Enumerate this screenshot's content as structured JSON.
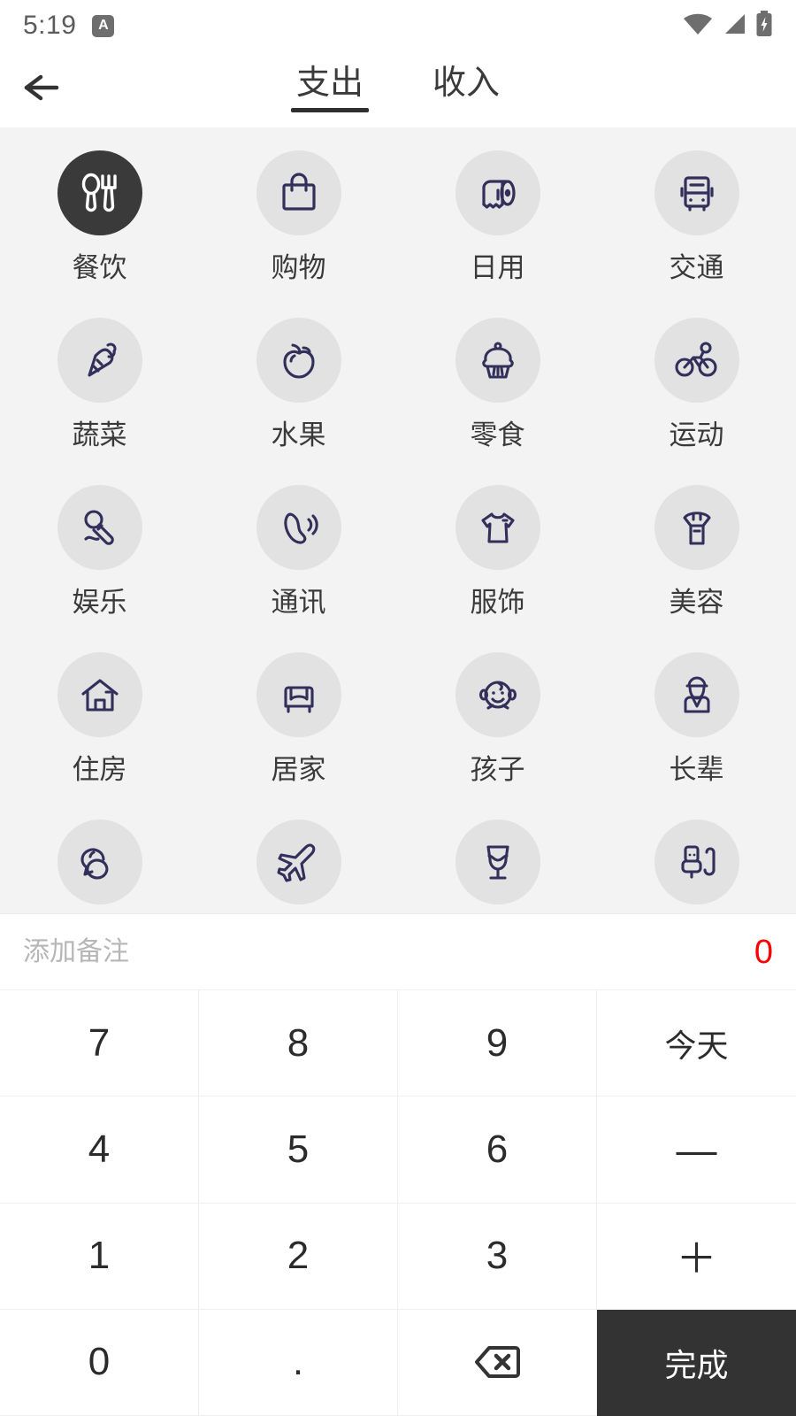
{
  "statusbar": {
    "time": "5:19",
    "badge_letter": "A",
    "icons": [
      "wifi-icon",
      "cellular-signal-icon",
      "battery-charging-icon"
    ]
  },
  "header": {
    "back_icon": "back-arrow-icon",
    "tabs": [
      {
        "label": "支出",
        "active": true
      },
      {
        "label": "收入",
        "active": false
      }
    ]
  },
  "categories": [
    {
      "label": "餐饮",
      "icon": "spoon-fork-icon",
      "selected": true
    },
    {
      "label": "购物",
      "icon": "shopping-bag-icon",
      "selected": false
    },
    {
      "label": "日用",
      "icon": "toilet-paper-icon",
      "selected": false
    },
    {
      "label": "交通",
      "icon": "bus-icon",
      "selected": false
    },
    {
      "label": "蔬菜",
      "icon": "carrot-icon",
      "selected": false
    },
    {
      "label": "水果",
      "icon": "apple-icon",
      "selected": false
    },
    {
      "label": "零食",
      "icon": "cupcake-icon",
      "selected": false
    },
    {
      "label": "运动",
      "icon": "bicycle-icon",
      "selected": false
    },
    {
      "label": "娱乐",
      "icon": "microphone-icon",
      "selected": false
    },
    {
      "label": "通讯",
      "icon": "phone-handset-icon",
      "selected": false
    },
    {
      "label": "服饰",
      "icon": "tshirt-icon",
      "selected": false
    },
    {
      "label": "美容",
      "icon": "lipstick-icon",
      "selected": false
    },
    {
      "label": "住房",
      "icon": "house-icon",
      "selected": false
    },
    {
      "label": "居家",
      "icon": "sofa-icon",
      "selected": false
    },
    {
      "label": "孩子",
      "icon": "baby-face-icon",
      "selected": false
    },
    {
      "label": "长辈",
      "icon": "elder-person-icon",
      "selected": false
    },
    {
      "label": "",
      "icon": "chat-bubbles-icon",
      "selected": false
    },
    {
      "label": "",
      "icon": "airplane-icon",
      "selected": false
    },
    {
      "label": "",
      "icon": "wine-glass-icon",
      "selected": false
    },
    {
      "label": "",
      "icon": "usb-cable-icon",
      "selected": false
    }
  ],
  "note": {
    "value": "",
    "placeholder": "添加备注",
    "amount": "0",
    "amount_color": "#ff0000"
  },
  "keypad": [
    {
      "label": "7",
      "kind": "digit"
    },
    {
      "label": "8",
      "kind": "digit"
    },
    {
      "label": "9",
      "kind": "digit"
    },
    {
      "label": "今天",
      "kind": "text"
    },
    {
      "label": "4",
      "kind": "digit"
    },
    {
      "label": "5",
      "kind": "digit"
    },
    {
      "label": "6",
      "kind": "digit"
    },
    {
      "label": "—",
      "kind": "op"
    },
    {
      "label": "1",
      "kind": "digit"
    },
    {
      "label": "2",
      "kind": "digit"
    },
    {
      "label": "3",
      "kind": "digit"
    },
    {
      "label": "＋",
      "kind": "op"
    },
    {
      "label": "0",
      "kind": "digit"
    },
    {
      "label": ".",
      "kind": "digit"
    },
    {
      "label": "",
      "kind": "backspace"
    },
    {
      "label": "完成",
      "kind": "done"
    }
  ],
  "colors": {
    "accent_dark": "#333333",
    "icon_navy": "#322f5a",
    "circle_bg": "#e2e2e2",
    "grid_bg": "#f3f3f3",
    "amount_red": "#ff0000"
  }
}
